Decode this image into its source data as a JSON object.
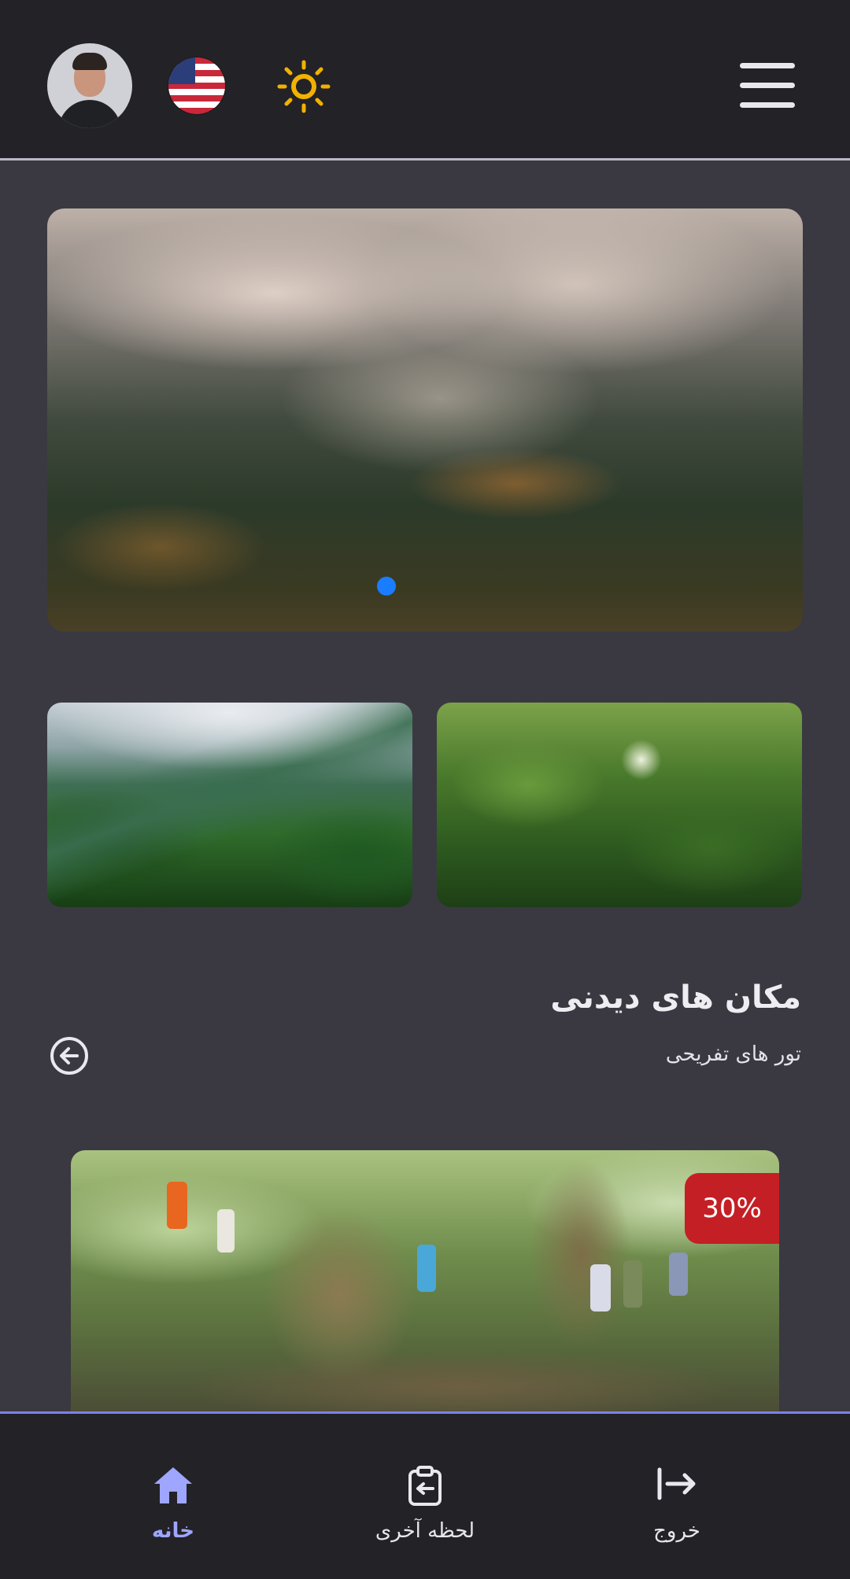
{
  "header": {
    "avatar": "user-avatar",
    "language_flag": "us-flag-icon",
    "theme_icon": "sun-icon",
    "menu_icon": "hamburger-menu-icon"
  },
  "hero": {
    "image": "misty-forest",
    "slide_indicator_color": "#1a7dff"
  },
  "gallery": [
    "tropical-mountain",
    "jungle-canopy"
  ],
  "section": {
    "title": "مکان های دیدنی",
    "subtitle": "تور های تفریحی",
    "back_icon": "arrow-left-circle-icon"
  },
  "tour_card": {
    "image": "banyan-tree-tour",
    "discount": "30%",
    "discount_color": "#c41f24"
  },
  "bottom_nav": {
    "items": [
      {
        "label": "خانه",
        "icon": "home-icon",
        "active": true
      },
      {
        "label": "لحظه آخری",
        "icon": "clipboard-icon",
        "active": false
      },
      {
        "label": "خروج",
        "icon": "logout-icon",
        "active": false
      }
    ],
    "active_color": "#9ea6ff"
  }
}
